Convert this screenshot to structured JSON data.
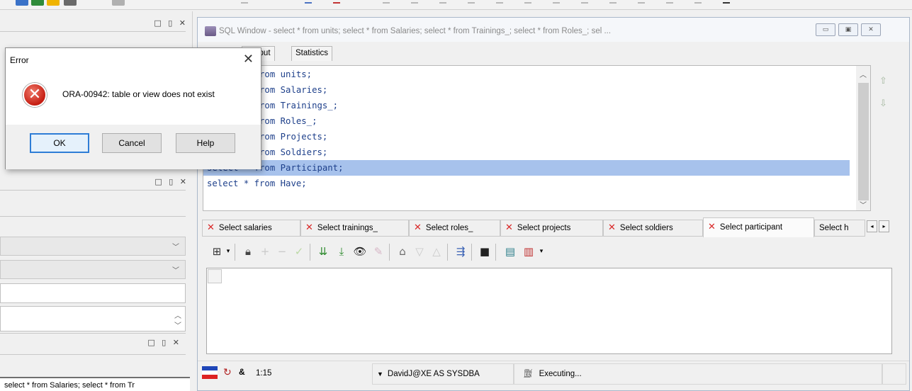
{
  "sql_window": {
    "title": "SQL Window - select * from units; select * from Salaries; select * from Trainings_; select * from Roles_; sel ...",
    "tabs": [
      "Output",
      "Statistics"
    ],
    "code_lines": [
      "select * from units;",
      "select * from Salaries;",
      "select * from Trainings_;",
      "select * from Roles_;",
      "select * from Projects;",
      "select * from Soldiers;",
      "select * from Participant;",
      "select * from Have;"
    ],
    "selected_line_index": 6
  },
  "result_tabs": [
    {
      "label": "Select salaries"
    },
    {
      "label": "Select trainings_"
    },
    {
      "label": "Select roles_"
    },
    {
      "label": "Select projects"
    },
    {
      "label": "Select soldiers"
    },
    {
      "label": "Select participant",
      "active": true
    },
    {
      "label": "Select h"
    }
  ],
  "status_bar": {
    "position": "1:15",
    "connection": "DavidJ@XE AS SYSDBA",
    "state": "Executing..."
  },
  "error_dialog": {
    "title": "Error",
    "message": "ORA-00942: table or view does not exist",
    "buttons": {
      "ok": "OK",
      "cancel": "Cancel",
      "help": "Help"
    }
  },
  "left_panel": {
    "bottom_text": "select * from Salaries; select * from Tr"
  },
  "icons": [
    "error-icon",
    "close-icon",
    "record-grid-icon",
    "lock-icon",
    "plus-icon",
    "minus-icon",
    "check-icon",
    "fetch-next-icon",
    "fetch-last-icon",
    "binoculars-icon",
    "eraser-icon",
    "query-icon",
    "arrow-down-icon",
    "arrow-up-icon",
    "export-icon",
    "save-icon",
    "printer-icon",
    "chart-icon"
  ],
  "colors": {
    "error_red": "#c51d12",
    "tab_close_red": "#d92626",
    "selection_blue": "#a7c2ec",
    "code_blue": "#1d3f8a",
    "default_button_border": "#2e7dd6"
  }
}
